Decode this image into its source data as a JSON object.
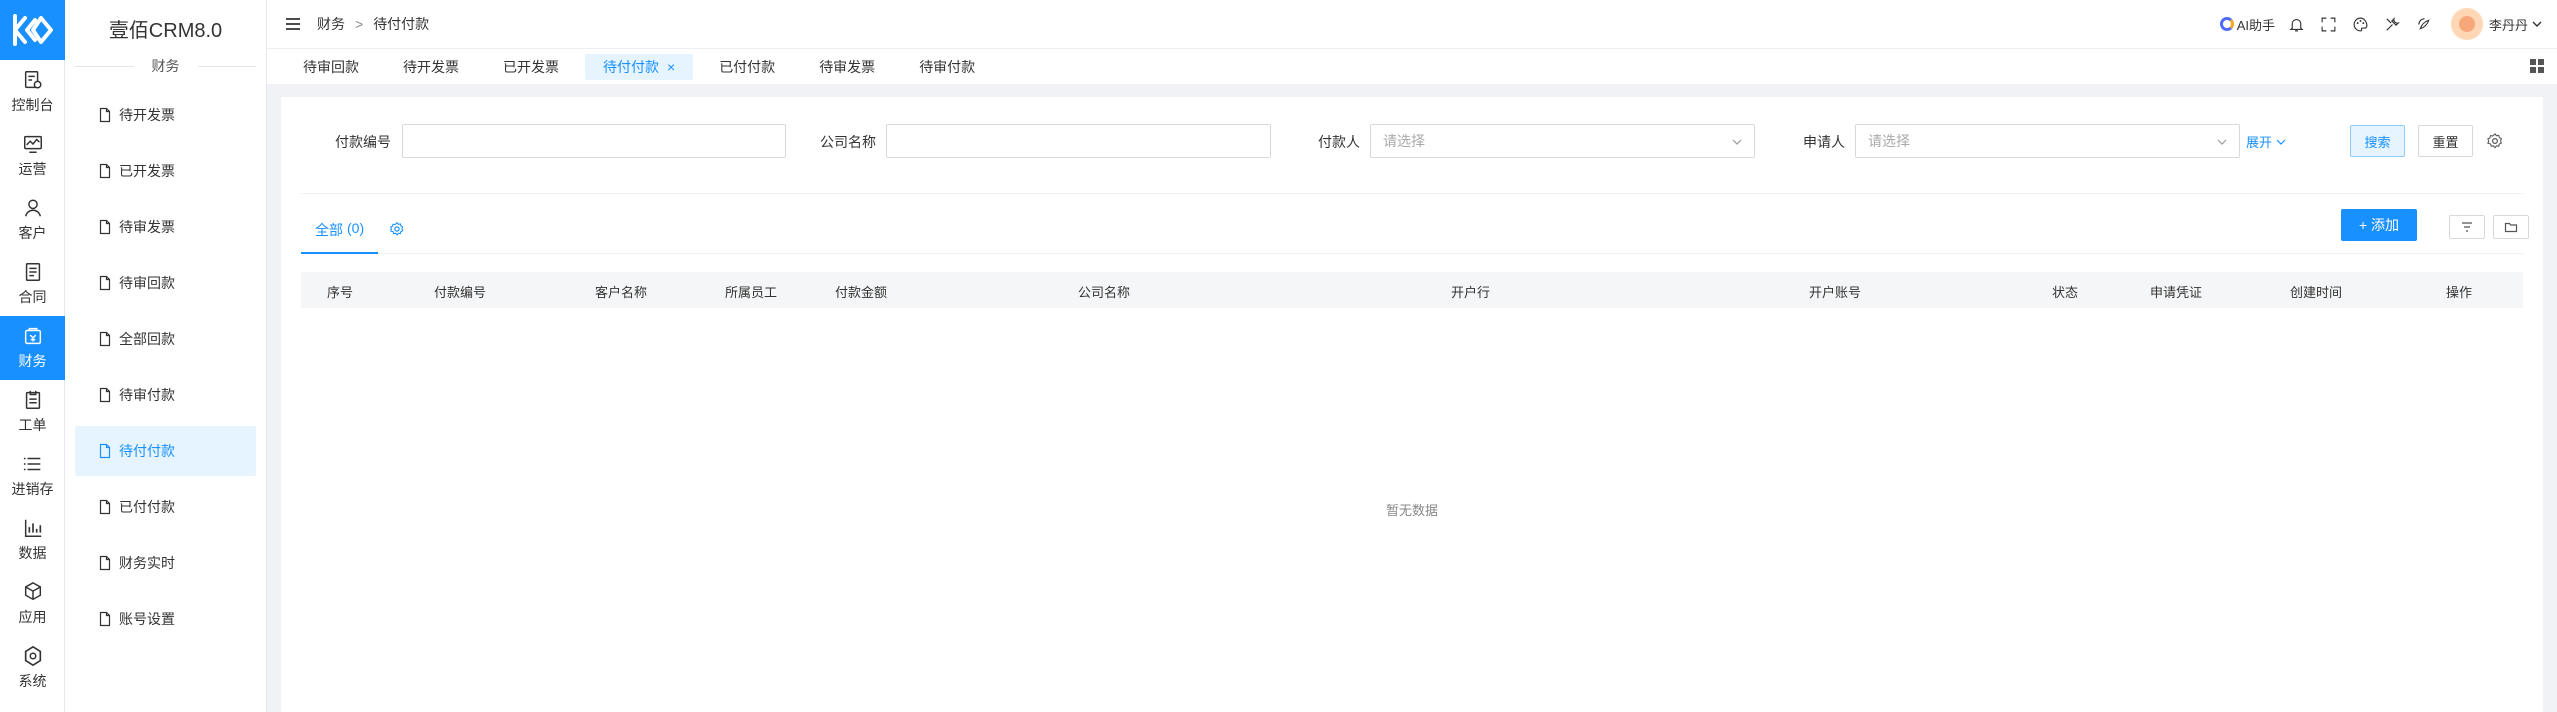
{
  "app": {
    "brand": "壹佰CRM8.0"
  },
  "rail": {
    "items": [
      {
        "label": "控制台",
        "icon": "dashboard-icon"
      },
      {
        "label": "运营",
        "icon": "operations-icon"
      },
      {
        "label": "客户",
        "icon": "user-icon"
      },
      {
        "label": "合同",
        "icon": "contract-icon"
      },
      {
        "label": "财务",
        "icon": "finance-icon",
        "active": true
      },
      {
        "label": "工单",
        "icon": "ticket-icon"
      },
      {
        "label": "进销存",
        "icon": "inventory-icon"
      },
      {
        "label": "数据",
        "icon": "data-icon"
      },
      {
        "label": "应用",
        "icon": "app-icon"
      },
      {
        "label": "系统",
        "icon": "system-icon"
      }
    ]
  },
  "submenu": {
    "title": "财务",
    "items": [
      {
        "label": "待开发票"
      },
      {
        "label": "已开发票"
      },
      {
        "label": "待审发票"
      },
      {
        "label": "待审回款"
      },
      {
        "label": "全部回款"
      },
      {
        "label": "待审付款"
      },
      {
        "label": "待付付款",
        "active": true
      },
      {
        "label": "已付付款"
      },
      {
        "label": "财务实时"
      },
      {
        "label": "账号设置"
      }
    ]
  },
  "header": {
    "breadcrumb": [
      "财务",
      "待付付款"
    ],
    "breadcrumb_sep": ">",
    "ai_label": "AI助手",
    "user_name": "李丹丹"
  },
  "tabs": [
    {
      "label": "待审回款"
    },
    {
      "label": "待开发票"
    },
    {
      "label": "已开发票"
    },
    {
      "label": "待付付款",
      "active": true,
      "close": "×"
    },
    {
      "label": "已付付款"
    },
    {
      "label": "待审发票"
    },
    {
      "label": "待审付款"
    }
  ],
  "filters": {
    "payment_no_label": "付款编号",
    "payment_no_value": "",
    "company_label": "公司名称",
    "company_value": "",
    "payer_label": "付款人",
    "payer_placeholder": "请选择",
    "applicant_label": "申请人",
    "applicant_placeholder": "请选择",
    "expand_label": "展开",
    "search_label": "搜索",
    "reset_label": "重置"
  },
  "list": {
    "tab_all_label": "全部",
    "tab_all_count": "(0)",
    "add_label": "+ 添加",
    "columns": [
      "序号",
      "付款编号",
      "客户名称",
      "所属员工",
      "付款金额",
      "公司名称",
      "开户行",
      "开户账号",
      "状态",
      "申请凭证",
      "创建时间",
      "操作"
    ],
    "empty_text": "暂无数据"
  },
  "colors": {
    "primary": "#1890ff",
    "primary_light": "#e6f4ff"
  }
}
